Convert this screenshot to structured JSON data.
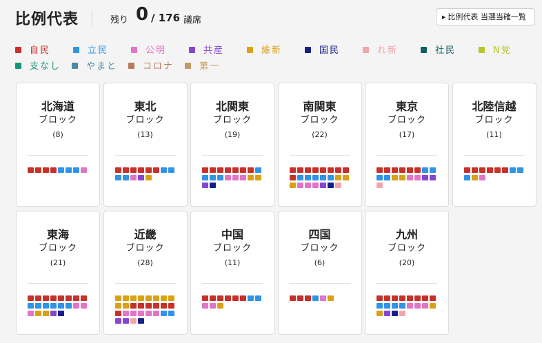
{
  "header": {
    "title": "比例代表",
    "remaining_label": "残り",
    "remaining": "0",
    "total": "/ 176",
    "seats_suffix": "議席",
    "list_button": "比例代表 当選当確一覧"
  },
  "parties": [
    {
      "key": "jimin",
      "label": "自民",
      "color": "#c8302a"
    },
    {
      "key": "rikken",
      "label": "立民",
      "color": "#2f94e8"
    },
    {
      "key": "komei",
      "label": "公明",
      "color": "#e275c6"
    },
    {
      "key": "kyosan",
      "label": "共産",
      "color": "#8647d0"
    },
    {
      "key": "ishin",
      "label": "維新",
      "color": "#daa114"
    },
    {
      "key": "kokumin",
      "label": "国民",
      "color": "#141f8c"
    },
    {
      "key": "reiwa",
      "label": "れ新",
      "color": "#f0a6aa"
    },
    {
      "key": "shamin",
      "label": "社民",
      "color": "#116262"
    },
    {
      "key": "ntou",
      "label": "N党",
      "color": "#b7c52f"
    },
    {
      "key": "shiji",
      "label": "支なし",
      "color": "#17957c"
    },
    {
      "key": "yamato",
      "label": "やまと",
      "color": "#4a8aa4"
    },
    {
      "key": "corona",
      "label": "コロナ",
      "color": "#b77a5c"
    },
    {
      "key": "daiichi",
      "label": "第一",
      "color": "#c39a5f"
    }
  ],
  "blocks": [
    {
      "name": "北海道",
      "label": "ブロック",
      "seats": "(8)",
      "dots": [
        "jimin",
        "jimin",
        "jimin",
        "jimin",
        "rikken",
        "rikken",
        "rikken",
        "komei"
      ]
    },
    {
      "name": "東北",
      "label": "ブロック",
      "seats": "(13)",
      "dots": [
        "jimin",
        "jimin",
        "jimin",
        "jimin",
        "jimin",
        "jimin",
        "rikken",
        "rikken",
        "rikken",
        "rikken",
        "komei",
        "kyosan",
        "ishin"
      ]
    },
    {
      "name": "北関東",
      "label": "ブロック",
      "seats": "(19)",
      "dots": [
        "jimin",
        "jimin",
        "jimin",
        "jimin",
        "jimin",
        "jimin",
        "jimin",
        "rikken",
        "rikken",
        "rikken",
        "rikken",
        "komei",
        "komei",
        "komei",
        "ishin",
        "ishin",
        "kyosan",
        "kokumin"
      ]
    },
    {
      "name": "南関東",
      "label": "ブロック",
      "seats": "(22)",
      "dots": [
        "jimin",
        "jimin",
        "jimin",
        "jimin",
        "jimin",
        "jimin",
        "jimin",
        "jimin",
        "jimin",
        "rikken",
        "rikken",
        "rikken",
        "rikken",
        "rikken",
        "ishin",
        "ishin",
        "ishin",
        "komei",
        "komei",
        "komei",
        "kyosan",
        "kokumin",
        "reiwa"
      ]
    },
    {
      "name": "東京",
      "label": "ブロック",
      "seats": "(17)",
      "dots": [
        "jimin",
        "jimin",
        "jimin",
        "jimin",
        "jimin",
        "jimin",
        "rikken",
        "rikken",
        "rikken",
        "rikken",
        "ishin",
        "ishin",
        "komei",
        "komei",
        "kyosan",
        "kyosan",
        "reiwa"
      ]
    },
    {
      "name": "北陸信越",
      "label": "ブロック",
      "seats": "(11)",
      "dots": [
        "jimin",
        "jimin",
        "jimin",
        "jimin",
        "jimin",
        "jimin",
        "rikken",
        "rikken",
        "rikken",
        "ishin",
        "komei"
      ]
    },
    {
      "name": "東海",
      "label": "ブロック",
      "seats": "(21)",
      "dots": [
        "jimin",
        "jimin",
        "jimin",
        "jimin",
        "jimin",
        "jimin",
        "jimin",
        "jimin",
        "rikken",
        "rikken",
        "rikken",
        "rikken",
        "rikken",
        "rikken",
        "komei",
        "komei",
        "komei",
        "ishin",
        "ishin",
        "kyosan",
        "kokumin"
      ]
    },
    {
      "name": "近畿",
      "label": "ブロック",
      "seats": "(28)",
      "dots": [
        "ishin",
        "ishin",
        "ishin",
        "ishin",
        "ishin",
        "ishin",
        "ishin",
        "ishin",
        "ishin",
        "ishin",
        "jimin",
        "jimin",
        "jimin",
        "jimin",
        "jimin",
        "jimin",
        "jimin",
        "komei",
        "komei",
        "komei",
        "komei",
        "komei",
        "rikken",
        "rikken",
        "kyosan",
        "kyosan",
        "reiwa",
        "kokumin"
      ]
    },
    {
      "name": "中国",
      "label": "ブロック",
      "seats": "(11)",
      "dots": [
        "jimin",
        "jimin",
        "jimin",
        "jimin",
        "jimin",
        "jimin",
        "rikken",
        "rikken",
        "komei",
        "komei",
        "ishin"
      ]
    },
    {
      "name": "四国",
      "label": "ブロック",
      "seats": "(6)",
      "dots": [
        "jimin",
        "jimin",
        "jimin",
        "rikken",
        "komei",
        "ishin"
      ]
    },
    {
      "name": "九州",
      "label": "ブロック",
      "seats": "(20)",
      "dots": [
        "jimin",
        "jimin",
        "jimin",
        "jimin",
        "jimin",
        "jimin",
        "jimin",
        "jimin",
        "rikken",
        "rikken",
        "rikken",
        "rikken",
        "komei",
        "komei",
        "komei",
        "ishin",
        "ishin",
        "kyosan",
        "kokumin",
        "reiwa"
      ]
    }
  ]
}
